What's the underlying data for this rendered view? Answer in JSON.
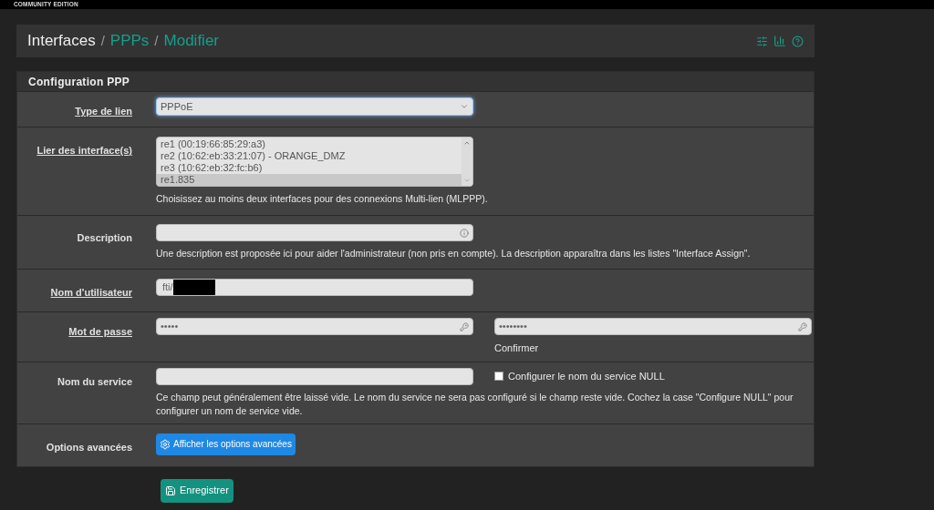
{
  "top_bar": {
    "edition": "COMMUNITY EDITION"
  },
  "breadcrumb": [
    {
      "label": "Interfaces",
      "link": false
    },
    {
      "label": "PPPs",
      "link": true
    },
    {
      "label": "Modifier",
      "link": true
    }
  ],
  "separator": "/",
  "panel": {
    "title": "Configuration PPP"
  },
  "fields": [
    {
      "kind": "select",
      "label": "Type de lien",
      "underlined": true,
      "value": "PPPoE"
    },
    {
      "kind": "listbox",
      "label": "Lier des interface(s)",
      "underlined": true,
      "options": [
        {
          "label": "re1 (00:19:66:85:29:a3)",
          "selected": false
        },
        {
          "label": "re2 (10:62:eb:33:21:07) - ORANGE_DMZ",
          "selected": false
        },
        {
          "label": "re3 (10:62:eb:32:fc:b6)",
          "selected": false
        },
        {
          "label": "re1.835",
          "selected": true
        }
      ],
      "help": "Choisissez au moins deux interfaces pour des connexions Multi-lien (MLPPP)."
    },
    {
      "kind": "text",
      "label": "Description",
      "underlined": false,
      "help": "Une description est proposée ici pour aider l'administrateur (non pris en compte). La description apparaîtra dans les listes \"Interface Assign\"."
    },
    {
      "kind": "username",
      "label": "Nom d'utilisateur",
      "underlined": true,
      "value": "fti/",
      "redacted": true
    },
    {
      "kind": "password",
      "label": "Mot de passe",
      "underlined": true,
      "value": "•••••",
      "confirm_value": "••••••••",
      "confirm_label": "Confirmer"
    },
    {
      "kind": "service",
      "label": "Nom du service",
      "underlined": false,
      "checkbox": {
        "label": "Configurer le nom du service NULL",
        "checked": false
      },
      "help": "Ce champ peut généralement être laissé vide. Le nom du service ne sera pas configuré si le champ reste vide. Cochez la case \"Configure NULL\" pour configurer un nom de service vide."
    },
    {
      "kind": "button",
      "label": "Options avancées",
      "underlined": false,
      "button": "Afficher les options avancées"
    }
  ],
  "save_button": "Enregistrer"
}
